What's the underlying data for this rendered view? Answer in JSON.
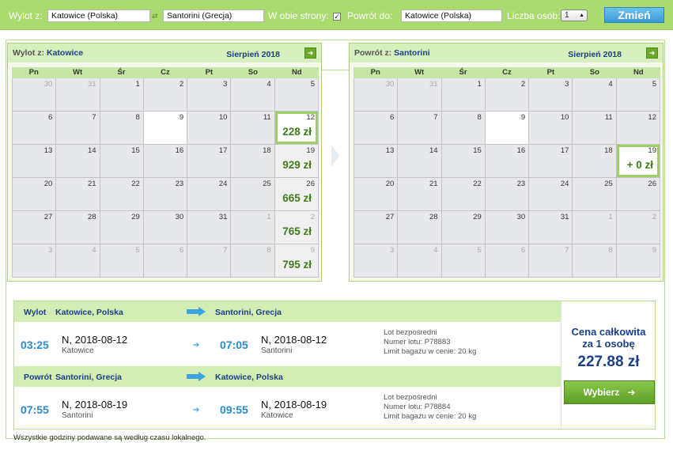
{
  "search": {
    "from_label": "Wylot z:",
    "from_value": "Katowice (Polska)",
    "to_value": "Santorini (Grecja)",
    "roundtrip_label": "W obie strony:",
    "roundtrip_checked": "✓",
    "return_label": "Powrót do:",
    "return_value": "Katowice (Polska)",
    "passengers_label": "Liczba osób:",
    "passengers_value": "1",
    "change_button": "Zmień"
  },
  "calendar_out": {
    "title_prefix": "Wylot z:",
    "city": "Katowice",
    "month": "Sierpień 2018",
    "weekdays": [
      "Pn",
      "Wt",
      "Śr",
      "Cz",
      "Pt",
      "So",
      "Nd"
    ],
    "days": [
      {
        "n": "30",
        "o": true
      },
      {
        "n": "31",
        "o": true
      },
      {
        "n": "1"
      },
      {
        "n": "2"
      },
      {
        "n": "3"
      },
      {
        "n": "4"
      },
      {
        "n": "5"
      },
      {
        "n": "6"
      },
      {
        "n": "7"
      },
      {
        "n": "8"
      },
      {
        "n": "9",
        "t": true
      },
      {
        "n": "10"
      },
      {
        "n": "11"
      },
      {
        "n": "12",
        "p": "228 zł",
        "s": true
      },
      {
        "n": "13"
      },
      {
        "n": "14"
      },
      {
        "n": "15"
      },
      {
        "n": "16"
      },
      {
        "n": "17"
      },
      {
        "n": "18"
      },
      {
        "n": "19",
        "p": "929 zł"
      },
      {
        "n": "20"
      },
      {
        "n": "21"
      },
      {
        "n": "22"
      },
      {
        "n": "23"
      },
      {
        "n": "24"
      },
      {
        "n": "25"
      },
      {
        "n": "26",
        "p": "665 zł"
      },
      {
        "n": "27"
      },
      {
        "n": "28"
      },
      {
        "n": "29"
      },
      {
        "n": "30"
      },
      {
        "n": "31"
      },
      {
        "n": "1",
        "o": true
      },
      {
        "n": "2",
        "o": true,
        "p": "765 zł"
      },
      {
        "n": "3",
        "o": true
      },
      {
        "n": "4",
        "o": true
      },
      {
        "n": "5",
        "o": true
      },
      {
        "n": "6",
        "o": true
      },
      {
        "n": "7",
        "o": true
      },
      {
        "n": "8",
        "o": true
      },
      {
        "n": "9",
        "o": true,
        "p": "795 zł"
      }
    ]
  },
  "calendar_ret": {
    "title_prefix": "Powrót z:",
    "city": "Santorini",
    "month": "Sierpień 2018",
    "weekdays": [
      "Pn",
      "Wt",
      "Śr",
      "Cz",
      "Pt",
      "So",
      "Nd"
    ],
    "days": [
      {
        "n": "30",
        "o": true
      },
      {
        "n": "31",
        "o": true
      },
      {
        "n": "1"
      },
      {
        "n": "2"
      },
      {
        "n": "3"
      },
      {
        "n": "4"
      },
      {
        "n": "5"
      },
      {
        "n": "6"
      },
      {
        "n": "7"
      },
      {
        "n": "8"
      },
      {
        "n": "9",
        "t": true
      },
      {
        "n": "10"
      },
      {
        "n": "11"
      },
      {
        "n": "12"
      },
      {
        "n": "13"
      },
      {
        "n": "14"
      },
      {
        "n": "15"
      },
      {
        "n": "16"
      },
      {
        "n": "17"
      },
      {
        "n": "18"
      },
      {
        "n": "19",
        "p": "+ 0 zł",
        "s": true
      },
      {
        "n": "20"
      },
      {
        "n": "21"
      },
      {
        "n": "22"
      },
      {
        "n": "23"
      },
      {
        "n": "24"
      },
      {
        "n": "25"
      },
      {
        "n": "26"
      },
      {
        "n": "27"
      },
      {
        "n": "28"
      },
      {
        "n": "29"
      },
      {
        "n": "30"
      },
      {
        "n": "31"
      },
      {
        "n": "1",
        "o": true
      },
      {
        "n": "2",
        "o": true
      },
      {
        "n": "3",
        "o": true
      },
      {
        "n": "4",
        "o": true
      },
      {
        "n": "5",
        "o": true
      },
      {
        "n": "6",
        "o": true
      },
      {
        "n": "7",
        "o": true
      },
      {
        "n": "8",
        "o": true
      },
      {
        "n": "9",
        "o": true
      }
    ]
  },
  "outbound": {
    "label": "Wylot",
    "from": "Katowice, Polska",
    "to": "Santorini, Grecja",
    "dep_time": "03:25",
    "dep_date": "N, 2018-08-12",
    "dep_place": "Katowice",
    "arr_time": "07:05",
    "arr_date": "N, 2018-08-12",
    "arr_place": "Santorini",
    "info1": "Lot bezpośredni",
    "info2": "Numer lotu: P78883",
    "info3": "Limit bagażu w cenie: 20 kg"
  },
  "inbound": {
    "label": "Powrót",
    "from": "Santorini, Grecja",
    "to": "Katowice, Polska",
    "dep_time": "07:55",
    "dep_date": "N, 2018-08-19",
    "dep_place": "Santorini",
    "arr_time": "09:55",
    "arr_date": "N, 2018-08-19",
    "arr_place": "Katowice",
    "info1": "Lot bezpośredni",
    "info2": "Numer lotu: P78884",
    "info3": "Limit bagażu w cenie: 20 kg"
  },
  "price": {
    "label_line1": "Cena całkowita",
    "label_line2": "za 1 osobę",
    "value": "227.88 zł",
    "select_button": "Wybierz"
  },
  "footnote": "Wszystkie godziny podawane są według czasu lokalnego."
}
